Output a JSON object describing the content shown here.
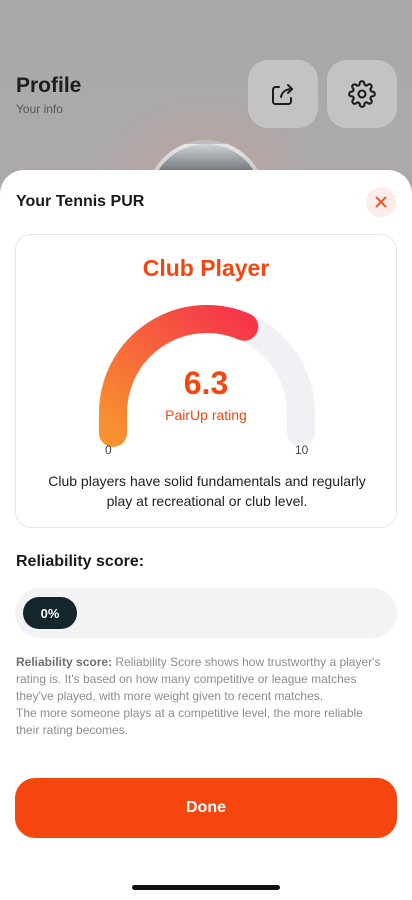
{
  "background": {
    "title": "Profile",
    "subtitle": "Your info",
    "share_icon": "share-icon",
    "settings_icon": "gear-icon"
  },
  "sheet": {
    "title": "Your Tennis PUR",
    "close_icon": "close-icon"
  },
  "rating_card": {
    "level": "Club Player",
    "rating": "6.3",
    "rating_label": "PairUp rating",
    "scale_min": "0",
    "scale_max": "10",
    "rating_fraction": 0.63,
    "description": "Club players have solid fundamentals and regularly play at recreational or club level."
  },
  "reliability": {
    "heading": "Reliability score:",
    "value": "0%",
    "value_fraction": 0,
    "info_title": "Reliability score:",
    "info_text": " Reliability Score shows how trustworthy a player's rating is. It's based on how many competitive or league matches they've played, with more weight given to recent matches.",
    "info_text_2": "The more someone plays at a competitive level, the more reliable their rating becomes."
  },
  "done_label": "Done",
  "colors": {
    "accent": "#f5460f",
    "gauge_start": "#f7922e",
    "gauge_end": "#f5364a",
    "gauge_track": "#f1f1f5",
    "pill": "#14262c"
  }
}
